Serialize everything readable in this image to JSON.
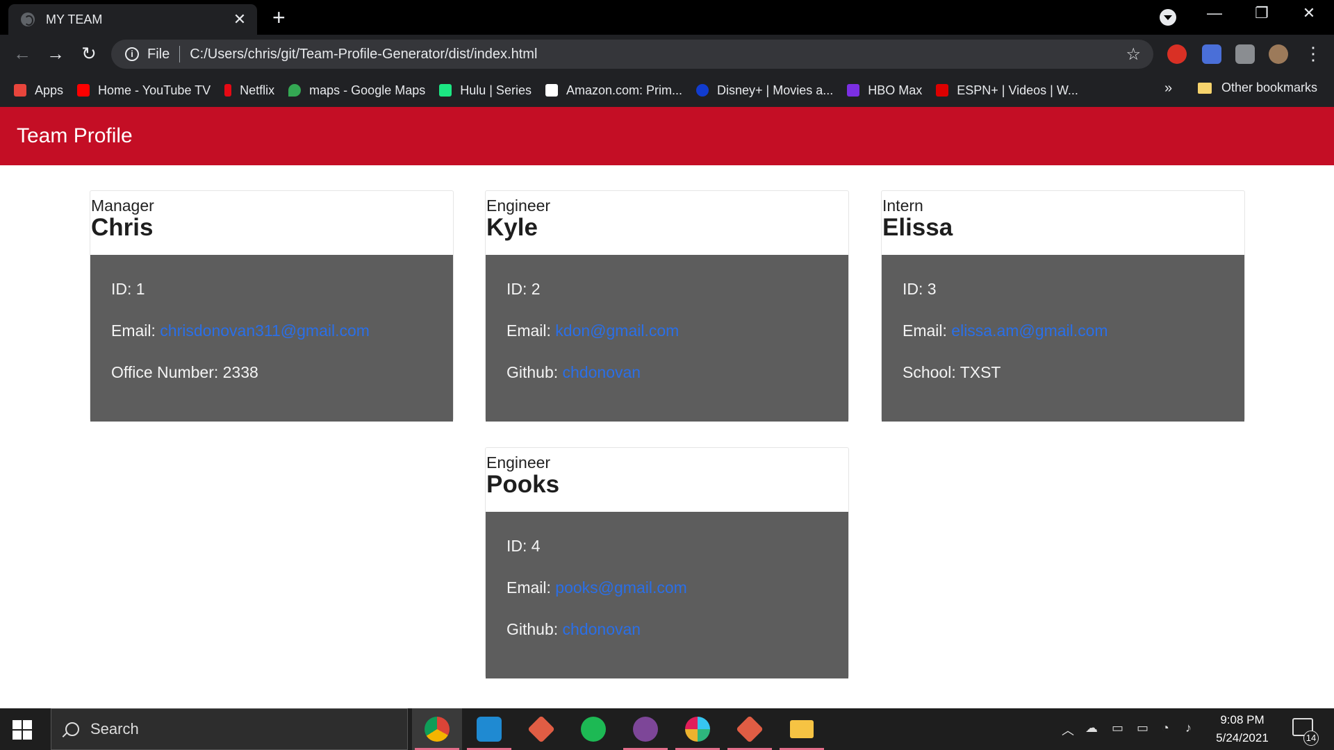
{
  "browser": {
    "tab_title": "MY TEAM",
    "tab_close": "✕",
    "new_tab": "+",
    "url_scheme": "File",
    "url": "C:/Users/chris/git/Team-Profile-Generator/dist/index.html",
    "window_controls": {
      "minimize": "—",
      "restore": "❐",
      "close": "✕"
    },
    "bookmarks": [
      {
        "label": "Apps",
        "icon": "apps-grid-icon",
        "color": "#e8453c"
      },
      {
        "label": "Home - YouTube TV",
        "icon": "youtube-icon",
        "color": "#ff0000"
      },
      {
        "label": "Netflix",
        "icon": "netflix-icon",
        "color": "#e50914"
      },
      {
        "label": "maps - Google Maps",
        "icon": "google-maps-icon",
        "color": "#34a853"
      },
      {
        "label": "Hulu | Series",
        "icon": "hulu-icon",
        "color": "#1ce783"
      },
      {
        "label": "Amazon.com: Prim...",
        "icon": "amazon-icon",
        "color": "#ffffff"
      },
      {
        "label": "Disney+ | Movies a...",
        "icon": "disney-plus-icon",
        "color": "#113ccf"
      },
      {
        "label": "HBO Max",
        "icon": "hbo-max-icon",
        "color": "#7b2fe3"
      },
      {
        "label": "ESPN+ | Videos | W...",
        "icon": "espn-icon",
        "color": "#d00"
      }
    ],
    "bookmarks_more": "»",
    "other_bookmarks": "Other bookmarks"
  },
  "page": {
    "header_title": "Team Profile",
    "accent_color": "#c40e25",
    "employees": [
      {
        "role": "Manager",
        "name": "Chris",
        "id_line": "ID: 1",
        "email_label": "Email:",
        "email": "chrisdonovan311@gmail.com",
        "extra_label": "Office Number:",
        "extra_value": "2338",
        "extra_is_link": false
      },
      {
        "role": "Engineer",
        "name": "Kyle",
        "id_line": "ID: 2",
        "email_label": "Email:",
        "email": "kdon@gmail.com",
        "extra_label": "Github:",
        "extra_value": "chdonovan",
        "extra_is_link": true
      },
      {
        "role": "Intern",
        "name": "Elissa",
        "id_line": "ID: 3",
        "email_label": "Email:",
        "email": "elissa.am@gmail.com",
        "extra_label": "School:",
        "extra_value": "TXST",
        "extra_is_link": false
      },
      {
        "role": "Engineer",
        "name": "Pooks",
        "id_line": "ID: 4",
        "email_label": "Email:",
        "email": "pooks@gmail.com",
        "extra_label": "Github:",
        "extra_value": "chdonovan",
        "extra_is_link": true
      }
    ]
  },
  "taskbar": {
    "search_label": "Search",
    "time": "9:08 PM",
    "date": "5/24/2021",
    "notification_count": "14",
    "apps": [
      {
        "name": "chrome-icon",
        "color": "#4285f4",
        "active": true
      },
      {
        "name": "vscode-icon",
        "color": "#1f8ad2",
        "active": true
      },
      {
        "name": "gitkraken-icon",
        "color": "#e05d44",
        "active": false
      },
      {
        "name": "spotify-icon",
        "color": "#1db954",
        "active": false
      },
      {
        "name": "tor-browser-icon",
        "color": "#7d4698",
        "active": true
      },
      {
        "name": "slack-icon",
        "color": "#e01e5a",
        "active": true
      },
      {
        "name": "git-gui-icon",
        "color": "#e05d44",
        "active": true
      },
      {
        "name": "file-explorer-icon",
        "color": "#f6c343",
        "active": true
      }
    ]
  }
}
